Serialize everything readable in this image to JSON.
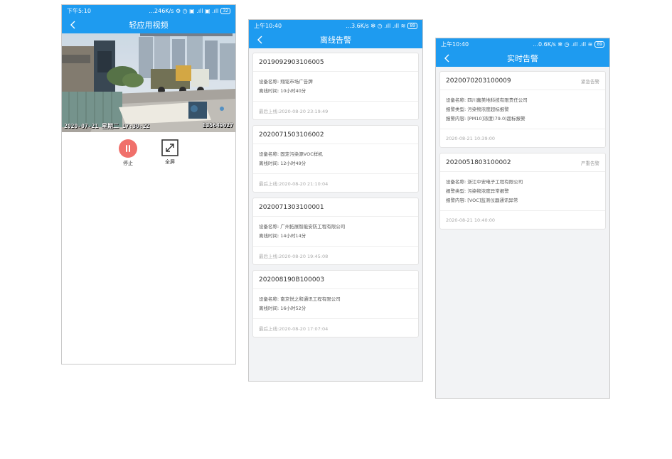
{
  "video_screen": {
    "status": {
      "time": "下午5:10",
      "right": "...246K/s ⚙ ◷ ▣ .ıll ▣ .ıll",
      "battery": "32"
    },
    "title": "轻应用视频",
    "osd_left": "2020-07-21  星期二  17:30:22",
    "osd_right": "E35649027",
    "stop_label": "停止",
    "fullscreen_label": "全屏"
  },
  "offline_screen": {
    "status": {
      "time": "上午10:40",
      "right": "...3.6K/s ✻ ◷ .ıll .ıll ≋",
      "battery": "89"
    },
    "title": "离线告警",
    "cards": [
      {
        "id": "2019092903106005",
        "device": "设备名称: 翔铭市场广告牌",
        "offline": "离线时间: 10小时40分",
        "last": "最后上线:2020-08-20 23:19:49"
      },
      {
        "id": "2020071503106002",
        "device": "设备名称: 固定污染源VOC样机",
        "offline": "离线时间: 12小时49分",
        "last": "最后上线:2020-08-20 21:10:04"
      },
      {
        "id": "2020071303100001",
        "device": "设备名称: 广州拓展智能安防工程有限公司",
        "offline": "离线时间: 14小时14分",
        "last": "最后上线:2020-08-20 19:45:08"
      },
      {
        "id": "202008190B100003",
        "device": "设备名称: 南京悦之和通讯工程有限公司",
        "offline": "离线时间: 16小时52分",
        "last": "最后上线:2020-08-20 17:07:04"
      }
    ]
  },
  "realtime_screen": {
    "status": {
      "time": "上午10:40",
      "right": "...0.6K/s ✻ ◷ .ıll .ıll ≋",
      "battery": "89"
    },
    "title": "实时告警",
    "cards": [
      {
        "id": "2020070203100009",
        "level": "紧急告警",
        "device": "设备名称: 四川嘉美地科技有限责任公司",
        "type": "报警类型: 污染物浓度超标报警",
        "content": "报警内容: [PM10]浓度(79.0)超标报警",
        "time": "2020-08-21 10:39:00"
      },
      {
        "id": "2020051803100002",
        "level": "严重告警",
        "device": "设备名称: 浙江中安电子工程有限公司",
        "type": "报警类型: 污染物浓度异常报警",
        "content": "报警内容: [VOC]监测仪器通讯异常",
        "time": "2020-08-21 10:40:00"
      }
    ]
  },
  "colors": {
    "primary": "#1e9bf0",
    "stop": "#f0706b"
  }
}
